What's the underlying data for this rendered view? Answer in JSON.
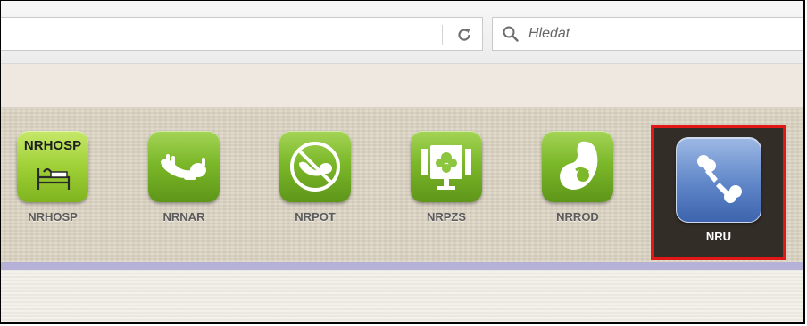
{
  "browser": {
    "search": {
      "placeholder": "Hledat"
    },
    "reload_icon": "reload-icon",
    "search_icon": "magnifier-icon"
  },
  "apps": [
    {
      "label": "NRHOSP",
      "icon_text": "NRHOSP",
      "icon": "hospital-bed-icon",
      "color": "#7cb82a"
    },
    {
      "label": "NRNAR",
      "icon": "newborn-icon",
      "color": "#7cb82a"
    },
    {
      "label": "NRPOT",
      "icon": "crossed-newborn-icon",
      "color": "#7cb82a"
    },
    {
      "label": "NRPZS",
      "icon": "medical-monitor-icon",
      "color": "#7cb82a"
    },
    {
      "label": "NRROD",
      "icon": "mother-child-icon",
      "color": "#7cb82a"
    },
    {
      "label": "NRU",
      "icon": "bone-fracture-icon",
      "color": "#5f86c8",
      "selected": true,
      "highlight": "#e01818"
    }
  ]
}
